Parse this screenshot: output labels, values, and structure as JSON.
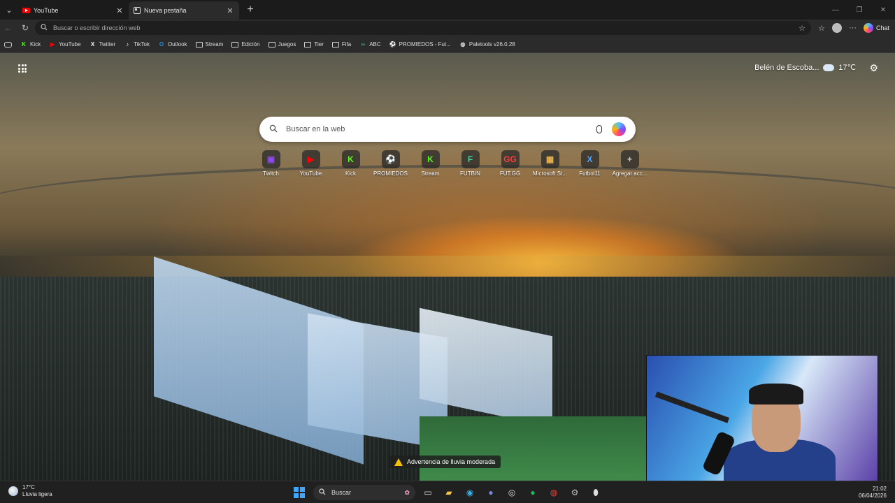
{
  "tabs": [
    {
      "title": "YouTube",
      "icon": "youtube-icon",
      "active": false
    },
    {
      "title": "Nueva pestaña",
      "icon": "newtab-icon",
      "active": true
    }
  ],
  "address": {
    "placeholder": "Buscar o escribir dirección web"
  },
  "toolbar": {
    "chat_label": "Chat"
  },
  "bookmarks": [
    {
      "label": "Kick",
      "icon": "K",
      "color": "#53fc18"
    },
    {
      "label": "YouTube",
      "icon": "▶",
      "color": "#ff0000"
    },
    {
      "label": "Twitter",
      "icon": "X",
      "color": "#ffffff"
    },
    {
      "label": "TikTok",
      "icon": "♪",
      "color": "#ffffff"
    },
    {
      "label": "Outlook",
      "icon": "O",
      "color": "#2a8bd8"
    },
    {
      "label": "Stream",
      "icon": "folder"
    },
    {
      "label": "Edición",
      "icon": "folder"
    },
    {
      "label": "Juegos",
      "icon": "folder"
    },
    {
      "label": "Tier",
      "icon": "folder"
    },
    {
      "label": "Fifa",
      "icon": "folder"
    },
    {
      "label": "ABC",
      "icon": "∞",
      "color": "#39b36b"
    },
    {
      "label": "PROMIEDOS - Fut...",
      "icon": "⚽",
      "color": "#2aa84a"
    },
    {
      "label": "Paletools v26.0.28",
      "icon": "◍",
      "color": "#dddddd"
    }
  ],
  "newtab": {
    "weather_location": "Belén de Escoba...",
    "weather_temp": "17℃",
    "search_placeholder": "Buscar en la web",
    "shortcuts": [
      {
        "label": "Twitch",
        "icon": "▣",
        "color": "#9146ff"
      },
      {
        "label": "YouTube",
        "icon": "▶",
        "color": "#ff0000"
      },
      {
        "label": "Kick",
        "icon": "K",
        "color": "#53fc18"
      },
      {
        "label": "PROMIEDOS",
        "icon": "⚽",
        "color": "#2aa84a"
      },
      {
        "label": "Stream",
        "icon": "K",
        "color": "#53fc18"
      },
      {
        "label": "FUTBIN",
        "icon": "F",
        "color": "#3ad1a0"
      },
      {
        "label": "FUT.GG",
        "icon": "GG",
        "color": "#ff3b3b"
      },
      {
        "label": "Microsoft St...",
        "icon": "▦",
        "color": "#e9b44c"
      },
      {
        "label": "Futbol11",
        "icon": "X",
        "color": "#4fa3ff"
      },
      {
        "label": "Agregar acc...",
        "icon": "+",
        "color": "#cccccc"
      }
    ]
  },
  "stream_overlay": {
    "warning_text": "Advertencia de lluvia moderada"
  },
  "taskbar": {
    "weather_temp": "17°C",
    "weather_desc": "Lluvia ligera",
    "search_label": "Buscar",
    "time": "21:02",
    "date": "06/04/2026"
  }
}
